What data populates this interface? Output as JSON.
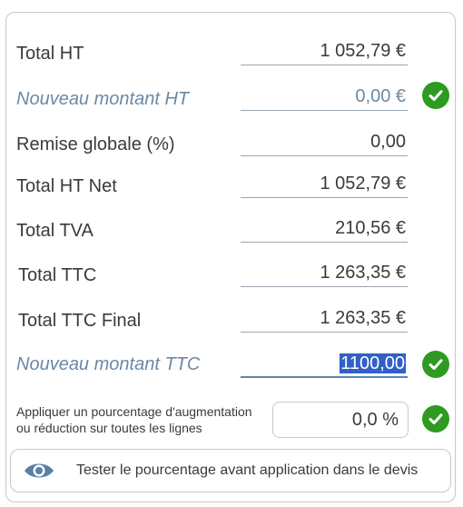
{
  "rows": [
    {
      "label": "Total HT",
      "value": "1 052,79 €"
    },
    {
      "label": "Nouveau montant HT",
      "value": "0,00 €"
    },
    {
      "label": "Remise globale (%)",
      "value": "0,00"
    },
    {
      "label": "Total HT Net",
      "value": "1 052,79 €"
    },
    {
      "label": "Total TVA",
      "value": "210,56 €"
    },
    {
      "label": "Total TTC",
      "value": "1 263,35 €"
    },
    {
      "label": "Total TTC Final",
      "value": "1 263,35 €"
    },
    {
      "label": "Nouveau montant TTC",
      "value": "1100,00"
    }
  ],
  "percentage": {
    "label_line1": "Appliquer un pourcentage d'augmentation",
    "label_line2": "ou réduction sur toutes les lignes",
    "value": "0,0 %"
  },
  "test_button": {
    "label": "Tester le pourcentage avant application dans le devis"
  },
  "icons": {
    "check": "check-circle-icon",
    "eye": "eye-icon"
  },
  "colors": {
    "check_green": "#2e9a1f",
    "italic_blue": "#6b88a6",
    "selection": "#3060c8"
  }
}
